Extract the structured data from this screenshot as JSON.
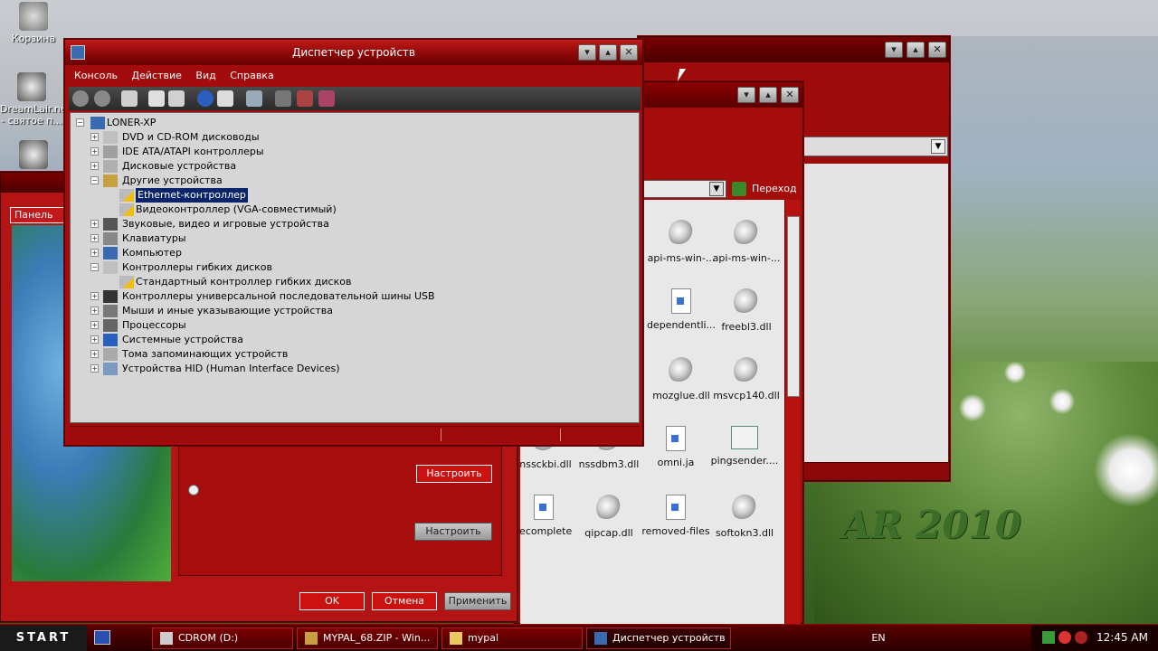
{
  "desktop": {
    "icons": [
      {
        "label": "Корзина"
      },
      {
        "label": "DreamLair.ne - святое п..."
      },
      {
        "label": ""
      }
    ],
    "watermark": "AR 2010"
  },
  "device_manager": {
    "title": "Диспетчер устройств",
    "menu": [
      "Консоль",
      "Действие",
      "Вид",
      "Справка"
    ],
    "tree": {
      "root": "LONER-XP",
      "nodes": [
        {
          "label": "DVD и CD-ROM дисководы",
          "expanded": false
        },
        {
          "label": "IDE ATA/ATAPI контроллеры",
          "expanded": false
        },
        {
          "label": "Дисковые устройства",
          "expanded": false
        },
        {
          "label": "Другие устройства",
          "expanded": true,
          "children": [
            "Ethernet-контроллер",
            "Видеоконтроллер (VGA-совместимый)"
          ]
        },
        {
          "label": "Звуковые, видео и игровые устройства",
          "expanded": false
        },
        {
          "label": "Клавиатуры",
          "expanded": false
        },
        {
          "label": "Компьютер",
          "expanded": false
        },
        {
          "label": "Контроллеры гибких дисков",
          "expanded": true,
          "children": [
            "Стандартный контроллер гибких дисков"
          ]
        },
        {
          "label": "Контроллеры универсальной последовательной шины USB",
          "expanded": false
        },
        {
          "label": "Мыши и иные указывающие устройства",
          "expanded": false
        },
        {
          "label": "Процессоры",
          "expanded": false
        },
        {
          "label": "Системные устройства",
          "expanded": false
        },
        {
          "label": "Тома запоминающих устройств",
          "expanded": false
        },
        {
          "label": "Устройства HID (Human Interface Devices)",
          "expanded": false
        }
      ],
      "selected": "Ethernet-контроллер"
    }
  },
  "file_window": {
    "go_label": "Переход",
    "files": [
      {
        "name": "api-ms-win-...",
        "icon": "gear"
      },
      {
        "name": "api-ms-win-...",
        "icon": "gear"
      },
      {
        "name": "dependentli...",
        "icon": "doc"
      },
      {
        "name": "freebl3.dll",
        "icon": "gear"
      },
      {
        "name": "mozglue.dll",
        "icon": "gear"
      },
      {
        "name": "msvcp140.dll",
        "icon": "gear"
      },
      {
        "name": "nssckbi.dll",
        "icon": "gear"
      },
      {
        "name": "nssdbm3.dll",
        "icon": "gear"
      },
      {
        "name": "omni.ja",
        "icon": "doc"
      },
      {
        "name": "pingsender....",
        "icon": "img"
      },
      {
        "name": "recomplete",
        "icon": "doc"
      },
      {
        "name": "qipcap.dll",
        "icon": "gear"
      },
      {
        "name": "removed-files",
        "icon": "doc"
      },
      {
        "name": "softokn3.dll",
        "icon": "gear"
      }
    ]
  },
  "panel_window": {
    "title": "Панель за",
    "configure_label": "Настроить",
    "configure2_label": "Настроить",
    "ok_label": "OK",
    "cancel_label": "Отмена",
    "apply_label": "Применить"
  },
  "taskbar": {
    "start": "START",
    "tasks": [
      {
        "label": "CDROM (D:)"
      },
      {
        "label": "MYPAL_68.ZIP - Win..."
      },
      {
        "label": "mypal"
      },
      {
        "label": "Диспетчер устройств"
      }
    ],
    "lang": "EN",
    "clock": "12:45 AM"
  },
  "colors": {
    "chrome_red": "#a30c0c",
    "selection": "#0a246a",
    "tree_bg": "#d6d6d6"
  }
}
